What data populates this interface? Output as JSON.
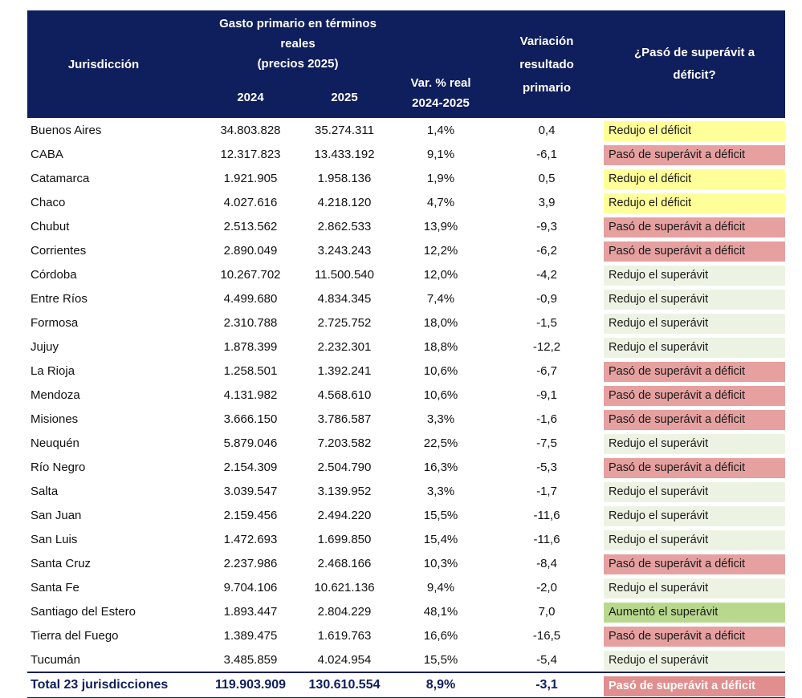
{
  "header": {
    "jurisdiccion": "Jurisdicción",
    "gasto_line1": "Gasto primario en términos reales",
    "gasto_line2": "(precios 2025)",
    "year_2024": "2024",
    "year_2025": "2025",
    "var_line1": "Var. % real",
    "var_line2": "2024-2025",
    "variacion_line1": "Variación",
    "variacion_line2": "resultado",
    "variacion_line3": "primario",
    "paso_line1": "¿Pasó de superávit a",
    "paso_line2": "déficit?"
  },
  "status_colors": {
    "yellow": "#ffff99",
    "red": "#e6a0a0",
    "light": "#edf3e3",
    "green": "#b8d98d",
    "header_bg": "#0f1e5c"
  },
  "rows": [
    {
      "name": "Buenos Aires",
      "v2024": "34.803.828",
      "v2025": "35.274.311",
      "var": "1,4%",
      "res": "0,4",
      "status": "Redujo el déficit",
      "color": "yellow"
    },
    {
      "name": "CABA",
      "v2024": "12.317.823",
      "v2025": "13.433.192",
      "var": "9,1%",
      "res": "-6,1",
      "status": "Pasó de superávit a déficit",
      "color": "red"
    },
    {
      "name": "Catamarca",
      "v2024": "1.921.905",
      "v2025": "1.958.136",
      "var": "1,9%",
      "res": "0,5",
      "status": "Redujo el déficit",
      "color": "yellow"
    },
    {
      "name": "Chaco",
      "v2024": "4.027.616",
      "v2025": "4.218.120",
      "var": "4,7%",
      "res": "3,9",
      "status": "Redujo el déficit",
      "color": "yellow"
    },
    {
      "name": "Chubut",
      "v2024": "2.513.562",
      "v2025": "2.862.533",
      "var": "13,9%",
      "res": "-9,3",
      "status": "Pasó de superávit a déficit",
      "color": "red"
    },
    {
      "name": "Corrientes",
      "v2024": "2.890.049",
      "v2025": "3.243.243",
      "var": "12,2%",
      "res": "-6,2",
      "status": "Pasó de superávit a déficit",
      "color": "red"
    },
    {
      "name": "Córdoba",
      "v2024": "10.267.702",
      "v2025": "11.500.540",
      "var": "12,0%",
      "res": "-4,2",
      "status": "Redujo el superávit",
      "color": "light"
    },
    {
      "name": "Entre Ríos",
      "v2024": "4.499.680",
      "v2025": "4.834.345",
      "var": "7,4%",
      "res": "-0,9",
      "status": "Redujo el superávit",
      "color": "light"
    },
    {
      "name": "Formosa",
      "v2024": "2.310.788",
      "v2025": "2.725.752",
      "var": "18,0%",
      "res": "-1,5",
      "status": "Redujo el superávit",
      "color": "light"
    },
    {
      "name": "Jujuy",
      "v2024": "1.878.399",
      "v2025": "2.232.301",
      "var": "18,8%",
      "res": "-12,2",
      "status": "Redujo el superávit",
      "color": "light"
    },
    {
      "name": "La Rioja",
      "v2024": "1.258.501",
      "v2025": "1.392.241",
      "var": "10,6%",
      "res": "-6,7",
      "status": "Pasó de superávit a déficit",
      "color": "red"
    },
    {
      "name": "Mendoza",
      "v2024": "4.131.982",
      "v2025": "4.568.610",
      "var": "10,6%",
      "res": "-9,1",
      "status": "Pasó de superávit a déficit",
      "color": "red"
    },
    {
      "name": "Misiones",
      "v2024": "3.666.150",
      "v2025": "3.786.587",
      "var": "3,3%",
      "res": "-1,6",
      "status": "Pasó de superávit a déficit",
      "color": "red"
    },
    {
      "name": "Neuquén",
      "v2024": "5.879.046",
      "v2025": "7.203.582",
      "var": "22,5%",
      "res": "-7,5",
      "status": "Redujo el superávit",
      "color": "light"
    },
    {
      "name": "Río Negro",
      "v2024": "2.154.309",
      "v2025": "2.504.790",
      "var": "16,3%",
      "res": "-5,3",
      "status": "Pasó de superávit a déficit",
      "color": "red"
    },
    {
      "name": "Salta",
      "v2024": "3.039.547",
      "v2025": "3.139.952",
      "var": "3,3%",
      "res": "-1,7",
      "status": "Redujo el superávit",
      "color": "light"
    },
    {
      "name": "San Juan",
      "v2024": "2.159.456",
      "v2025": "2.494.220",
      "var": "15,5%",
      "res": "-11,6",
      "status": "Redujo el superávit",
      "color": "light"
    },
    {
      "name": "San Luis",
      "v2024": "1.472.693",
      "v2025": "1.699.850",
      "var": "15,4%",
      "res": "-11,6",
      "status": "Redujo el superávit",
      "color": "light"
    },
    {
      "name": "Santa Cruz",
      "v2024": "2.237.986",
      "v2025": "2.468.166",
      "var": "10,3%",
      "res": "-8,4",
      "status": "Pasó de superávit a déficit",
      "color": "red"
    },
    {
      "name": "Santa Fe",
      "v2024": "9.704.106",
      "v2025": "10.621.136",
      "var": "9,4%",
      "res": "-2,0",
      "status": "Redujo el superávit",
      "color": "light"
    },
    {
      "name": "Santiago del Estero",
      "v2024": "1.893.447",
      "v2025": "2.804.229",
      "var": "48,1%",
      "res": "7,0",
      "status": "Aumentó el superávit",
      "color": "green"
    },
    {
      "name": "Tierra del Fuego",
      "v2024": "1.389.475",
      "v2025": "1.619.763",
      "var": "16,6%",
      "res": "-16,5",
      "status": "Pasó de superávit a déficit",
      "color": "red"
    },
    {
      "name": "Tucumán",
      "v2024": "3.485.859",
      "v2025": "4.024.954",
      "var": "15,5%",
      "res": "-5,4",
      "status": "Redujo el superávit",
      "color": "light"
    }
  ],
  "total": {
    "name": "Total 23 jurisdicciones",
    "v2024": "119.903.909",
    "v2025": "130.610.554",
    "var": "8,9%",
    "res": "-3,1",
    "status": "Pasó de superávit a déficit"
  }
}
